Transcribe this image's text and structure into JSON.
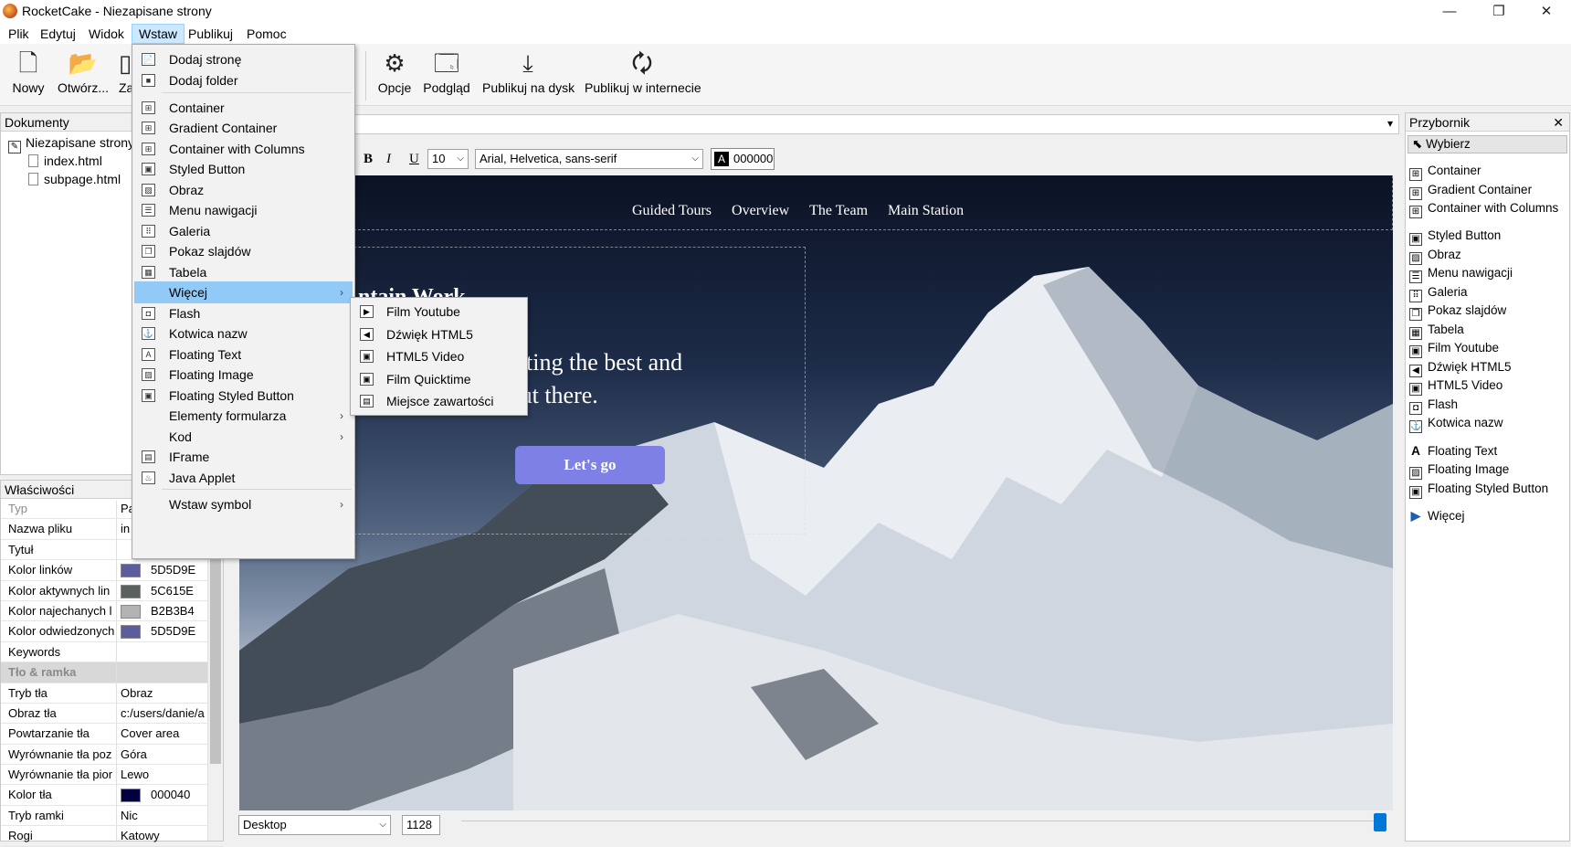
{
  "window": {
    "title": "RocketCake - Niezapisane strony",
    "minimize": "—",
    "maximize": "❐",
    "close": "✕"
  },
  "menubar": [
    "Plik",
    "Edytuj",
    "Widok",
    "Wstaw",
    "Publikuj",
    "Pomoc"
  ],
  "toolbar": {
    "new": "Nowy",
    "open": "Otwórz...",
    "save": "Za",
    "options": "Opcje",
    "preview": "Podgląd",
    "publish_disk": "Publikuj na dysk",
    "publish_web": "Publikuj w internecie"
  },
  "documents": {
    "header": "Dokumenty",
    "root": "Niezapisane strony",
    "files": [
      "index.html",
      "subpage.html"
    ]
  },
  "properties": {
    "header": "Właściwości",
    "rows": [
      {
        "k": "Typ",
        "v": "Pa",
        "dim": true
      },
      {
        "k": "Nazwa pliku",
        "v": "in"
      },
      {
        "k": "Tytuł",
        "v": ""
      },
      {
        "k": "Kolor linków",
        "v": "5D5D9E",
        "color": "#5D5D9E"
      },
      {
        "k": "Kolor aktywnych lin",
        "v": "5C615E",
        "color": "#5C615E"
      },
      {
        "k": "Kolor najechanych l",
        "v": "B2B3B4",
        "color": "#B2B3B4"
      },
      {
        "k": "Kolor odwiedzonych",
        "v": "5D5D9E",
        "color": "#5D5D9E"
      },
      {
        "k": "Keywords",
        "v": ""
      },
      {
        "k": "Tło & ramka",
        "v": "",
        "section": true
      },
      {
        "k": "Tryb tła",
        "v": "Obraz"
      },
      {
        "k": "Obraz tła",
        "v": "c:/users/danie/a"
      },
      {
        "k": "Powtarzanie tła",
        "v": "Cover area"
      },
      {
        "k": "Wyrównanie tła poz",
        "v": "Góra"
      },
      {
        "k": "Wyrównanie tła pior",
        "v": "Lewo"
      },
      {
        "k": "Kolor tła",
        "v": "000040",
        "color": "#000040"
      },
      {
        "k": "Tryb ramki",
        "v": "Nic"
      },
      {
        "k": "Rogi",
        "v": "Katowy"
      }
    ]
  },
  "format": {
    "bold": "B",
    "italic": "I",
    "underline": "U",
    "size": "10",
    "font": "Arial, Helvetica, sans-serif",
    "color_label": "A",
    "color": "000000"
  },
  "page": {
    "nav": [
      "Guided Tours",
      "Overview",
      "The Team",
      "Main Station"
    ],
    "heading": "ntain Work",
    "hero_line1_bold": "rk",
    "hero_line1": " are creating the best and",
    "hero_line2": "ountains out there.",
    "cta": "Let's go"
  },
  "bottom": {
    "view": "Desktop",
    "width": "1128"
  },
  "toolbox": {
    "header": "Przybornik",
    "select": "Wybierz",
    "items": [
      "Container",
      "Gradient Container",
      "Container with Columns",
      "Styled Button",
      "Obraz",
      "Menu nawigacji",
      "Galeria",
      "Pokaz slajdów",
      "Tabela",
      "Film Youtube",
      "Dźwięk HTML5",
      "HTML5 Video",
      "Flash",
      "Kotwica nazw",
      "Floating Text",
      "Floating Image",
      "Floating Styled Button",
      "Więcej"
    ]
  },
  "insert_menu": {
    "items": [
      "Dodaj stronę",
      "Dodaj folder",
      "Container",
      "Gradient Container",
      "Container with Columns",
      "Styled Button",
      "Obraz",
      "Menu nawigacji",
      "Galeria",
      "Pokaz slajdów",
      "Tabela",
      "Więcej",
      "Flash",
      "Kotwica nazw",
      "Floating Text",
      "Floating Image",
      "Floating Styled Button",
      "Elementy formularza",
      "Kod",
      "IFrame",
      "Java Applet",
      "Wstaw symbol"
    ],
    "highlighted": "Więcej"
  },
  "more_submenu": [
    "Film Youtube",
    "Dźwięk HTML5",
    "HTML5 Video",
    "Film Quicktime",
    "Miejsce zawartości"
  ]
}
